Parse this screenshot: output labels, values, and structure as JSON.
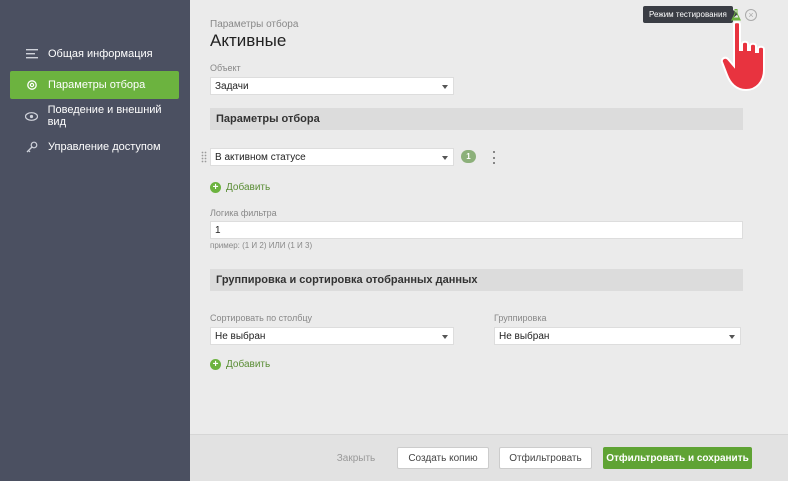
{
  "sidebar": {
    "items": [
      {
        "label": "Общая информация",
        "icon": "list-icon",
        "active": false
      },
      {
        "label": "Параметры отбора",
        "icon": "gear-icon",
        "active": true
      },
      {
        "label": "Поведение и внешний вид",
        "icon": "eye-icon",
        "active": false
      },
      {
        "label": "Управление доступом",
        "icon": "key-icon",
        "active": false
      }
    ]
  },
  "header": {
    "breadcrumb": "Параметры отбора",
    "title": "Активные"
  },
  "object": {
    "label": "Объект",
    "value": "Задачи"
  },
  "filters": {
    "section_title": "Параметры отбора",
    "condition_value": "В активном статусе",
    "condition_badge": "1",
    "add_label": "Добавить"
  },
  "logic": {
    "label": "Логика фильтра",
    "value": "1",
    "hint": "пример: (1 И 2) ИЛИ (1 И 3)"
  },
  "grouping": {
    "section_title": "Группировка и сортировка отобранных данных",
    "sort_label": "Сортировать по столбцу",
    "sort_value": "Не выбран",
    "group_label": "Группировка",
    "group_value": "Не выбран",
    "add_label": "Добавить"
  },
  "footer": {
    "close": "Закрыть",
    "copy": "Создать копию",
    "filter": "Отфильтровать",
    "filter_save": "Отфильтровать и сохранить"
  },
  "test_mode": {
    "tooltip": "Режим тестирования"
  },
  "colors": {
    "sidebar_bg": "#4b5061",
    "accent": "#6cb33f",
    "cursor": "#e8333f"
  }
}
